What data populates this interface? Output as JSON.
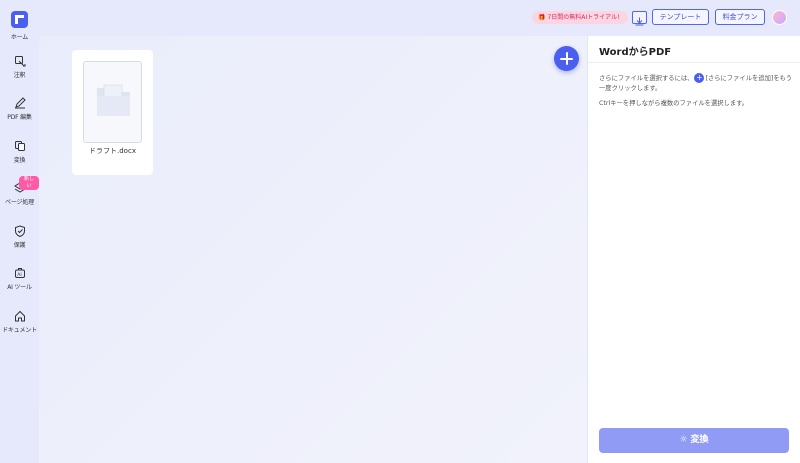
{
  "sidebar": {
    "items": [
      {
        "label": "ホーム",
        "icon": "home-logo-icon"
      },
      {
        "label": "注釈",
        "icon": "annotate-icon"
      },
      {
        "label": "PDF 編集",
        "icon": "edit-icon"
      },
      {
        "label": "変換",
        "icon": "convert-icon"
      },
      {
        "label": "ページ処理",
        "icon": "layers-icon",
        "badge": "新しい"
      },
      {
        "label": "保護",
        "icon": "shield-icon"
      },
      {
        "label": "AI ツール",
        "icon": "ai-tools-icon"
      },
      {
        "label": "ドキュメント",
        "icon": "home-icon"
      }
    ]
  },
  "topbar": {
    "trial": "7日間の無料AIトライアル!",
    "template_btn": "テンプレート",
    "pricing_btn": "料金プラン"
  },
  "main": {
    "files": [
      {
        "name": "ドラフト.docx"
      }
    ]
  },
  "panel": {
    "title": "WordからPDF",
    "instruction_before": "さらにファイルを選択するには、",
    "instruction_after": "[さらにファイルを追加]をもう一度クリックします。",
    "instruction_ctrl": "Ctrlキーを押しながら複数のファイルを選択します。",
    "convert_label": "変換"
  },
  "colors": {
    "accent": "#4a5ef0",
    "convert_button": "#8f9bf5",
    "badge": "#ff5aa5"
  }
}
